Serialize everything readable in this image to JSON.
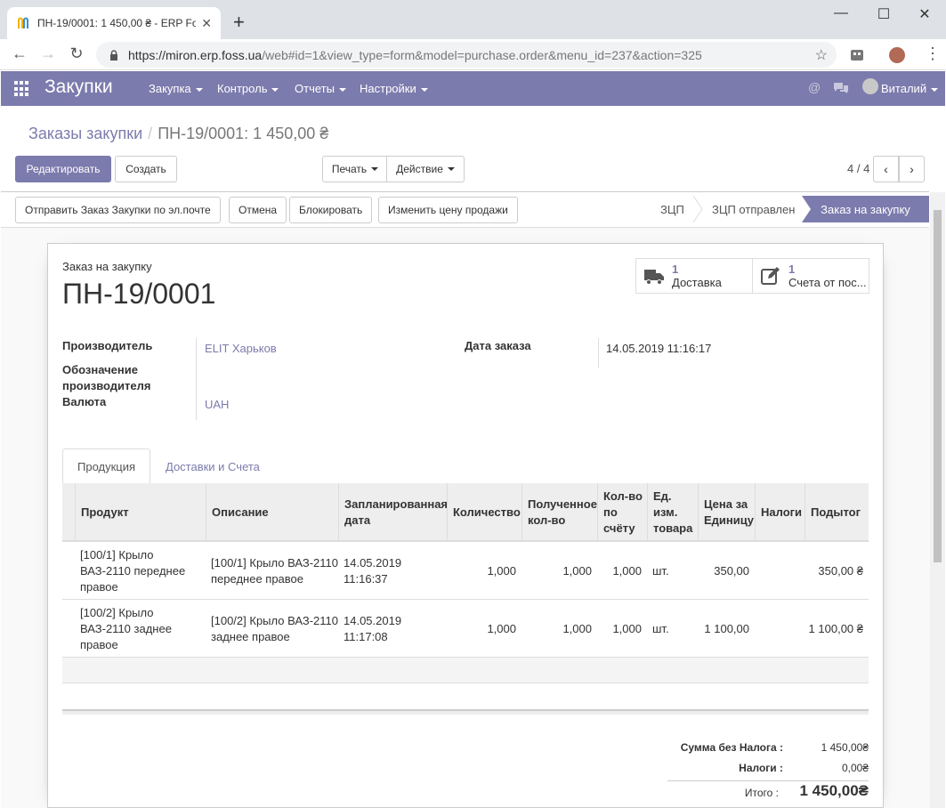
{
  "browser": {
    "tab_title": "ПН-19/0001: 1 450,00 ₴ - ERP Fo",
    "url_host": "https://miron.erp.foss.ua",
    "url_path": "/web#id=1&view_type=form&model=purchase.order&menu_id=237&action=325"
  },
  "nav": {
    "brand": "Закупки",
    "menus": [
      "Закупка",
      "Контроль",
      "Отчеты",
      "Настройки"
    ],
    "user": "Виталий"
  },
  "breadcrumb": {
    "parent": "Заказы закупки",
    "current": "ПН-19/0001: 1 450,00 ₴"
  },
  "buttons": {
    "edit": "Редактировать",
    "create": "Создать",
    "print": "Печать",
    "action": "Действие"
  },
  "pager": "4 / 4",
  "status_buttons": [
    "Отправить Заказ Закупки по эл.почте",
    "Отмена",
    "Блокировать",
    "Изменить цену продажи"
  ],
  "stages": [
    "ЗЦП",
    "ЗЦП отправлен",
    "Заказ на закупку"
  ],
  "form": {
    "doc_label": "Заказ на закупку",
    "doc_name": "ПН-19/0001",
    "smart_buttons": [
      {
        "count": "1",
        "label": "Доставка"
      },
      {
        "count": "1",
        "label": "Счета от пос..."
      }
    ],
    "fields": {
      "vendor_label": "Производитель",
      "vendor_value": "ELIT Харьков",
      "vendor_ref_label": "Обозначение производителя",
      "currency_label": "Валюта",
      "currency_value": "UAH",
      "order_date_label": "Дата заказа",
      "order_date_value": "14.05.2019 11:16:17"
    },
    "tabs": [
      "Продукция",
      "Доставки и Счета"
    ]
  },
  "table": {
    "columns": [
      "Продукт",
      "Описание",
      "Запланированная дата",
      "Количество",
      "Полученное кол-во",
      "Кол-во по счёту",
      "Ед. изм. товара",
      "Цена за Единицу",
      "Налоги",
      "Подытог"
    ],
    "rows": [
      [
        "[100/1] Крыло ВАЗ-2110 переднее правое",
        "[100/1] Крыло ВАЗ-2110 переднее правое",
        "14.05.2019 11:16:37",
        "1,000",
        "1,000",
        "1,000",
        "шт.",
        "350,00",
        "",
        "350,00 ₴"
      ],
      [
        "[100/2] Крыло ВАЗ-2110 заднее правое",
        "[100/2] Крыло ВАЗ-2110 заднее правое",
        "14.05.2019 11:17:08",
        "1,000",
        "1,000",
        "1,000",
        "шт.",
        "1 100,00",
        "",
        "1 100,00 ₴"
      ]
    ]
  },
  "totals": {
    "untaxed_label": "Сумма без Налога :",
    "untaxed_value": "1 450,00₴",
    "taxes_label": "Налоги :",
    "taxes_value": "0,00₴",
    "total_label": "Итого :",
    "total_value": "1 450,00₴"
  }
}
